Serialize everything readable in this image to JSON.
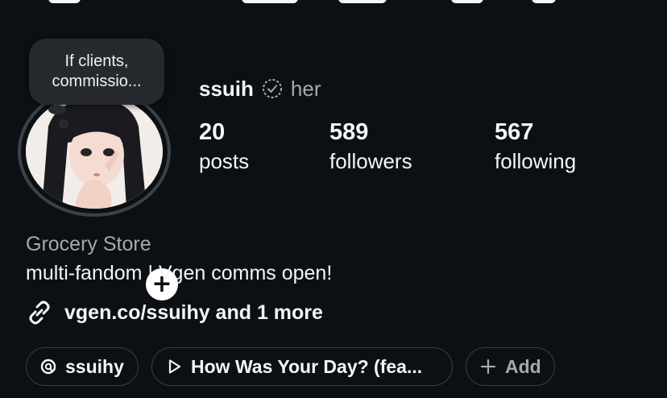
{
  "note": {
    "text": "If clients,\ncommissio..."
  },
  "profile": {
    "username": "ssuih",
    "pronouns": "her",
    "verified_icon": "verified-badge-icon"
  },
  "stats": [
    {
      "value": "20",
      "label": "posts"
    },
    {
      "value": "589",
      "label": "followers"
    },
    {
      "value": "567",
      "label": "following"
    }
  ],
  "bio": {
    "category": "Grocery Store",
    "text": "multi-fandom | Vgen comms open!",
    "link": "vgen.co/ssuihy and 1 more"
  },
  "chips": [
    {
      "icon": "threads-icon",
      "label": "ssuihy"
    },
    {
      "icon": "play-icon",
      "label": "How Was Your Day? (fea..."
    },
    {
      "icon": "plus-icon",
      "label": "Add"
    }
  ],
  "colors": {
    "background": "#0c1014",
    "text": "#f5f5f5",
    "muted": "#a8a8a8",
    "note_bubble": "#262a2f",
    "avatar_ring": "#3b4148"
  }
}
